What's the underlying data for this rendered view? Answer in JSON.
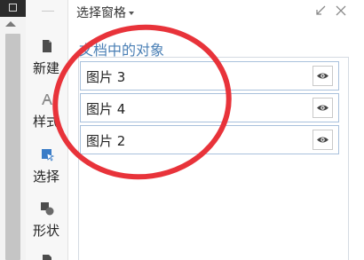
{
  "toolbar": {
    "items": [
      {
        "label": "新建",
        "icon": "new-document-icon"
      },
      {
        "label": "样式",
        "icon": "style-icon"
      },
      {
        "label": "选择",
        "icon": "select-icon"
      },
      {
        "label": "形状",
        "icon": "shape-icon"
      }
    ]
  },
  "pane": {
    "title": "选择窗格",
    "section_title": "文档中的对象",
    "objects": [
      {
        "name": "图片 3",
        "visibility_icon": "eye-icon"
      },
      {
        "name": "图片 4",
        "visibility_icon": "eye-icon"
      },
      {
        "name": "图片 2",
        "visibility_icon": "eye-icon"
      }
    ]
  },
  "colors": {
    "section_title": "#4a7fb5",
    "item_border": "#a9c1dc",
    "annotation": "#e8333a"
  }
}
